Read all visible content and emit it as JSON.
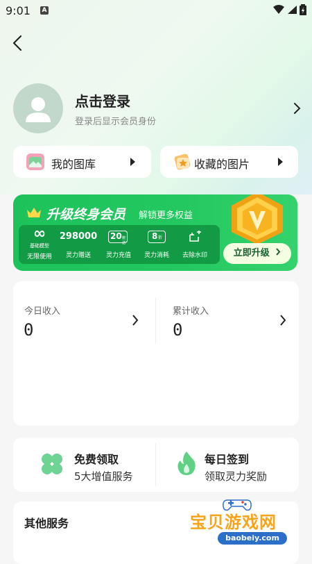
{
  "status_bar": {
    "time": "9:01",
    "app_badge": "A"
  },
  "profile": {
    "title": "点击登录",
    "subtitle": "登录后显示会员身份"
  },
  "quick_cards": [
    {
      "label": "我的图库"
    },
    {
      "label": "收藏的图片"
    }
  ],
  "vip": {
    "title": "升级终身会员",
    "subtitle": "解锁更多权益",
    "badge_letter": "V",
    "perks": [
      {
        "top": "∞",
        "top_sub": "基础模型",
        "bottom": "无限使用"
      },
      {
        "top": "298000",
        "bottom": "灵力赠送"
      },
      {
        "top": "20",
        "top_sub": "赠送",
        "bottom": "灵力充值"
      },
      {
        "top": "8",
        "top_sub": "折",
        "bottom": "灵力消耗"
      },
      {
        "top": "",
        "bottom": "去除水印"
      }
    ],
    "upgrade_label": "立即升级"
  },
  "income": {
    "today_label": "今日收入",
    "today_value": "0",
    "total_label": "累计收入",
    "total_value": "0"
  },
  "services": [
    {
      "title": "免费领取",
      "subtitle": "5大增值服务"
    },
    {
      "title": "每日签到",
      "subtitle": "领取灵力奖励"
    }
  ],
  "other": {
    "title": "其他服务"
  },
  "watermark": {
    "text": "宝贝游戏网",
    "url": "baobeiy.com"
  },
  "colors": {
    "brand_green": "#22c55e",
    "dark_green": "#139a44",
    "gold": "#f5b81c"
  }
}
